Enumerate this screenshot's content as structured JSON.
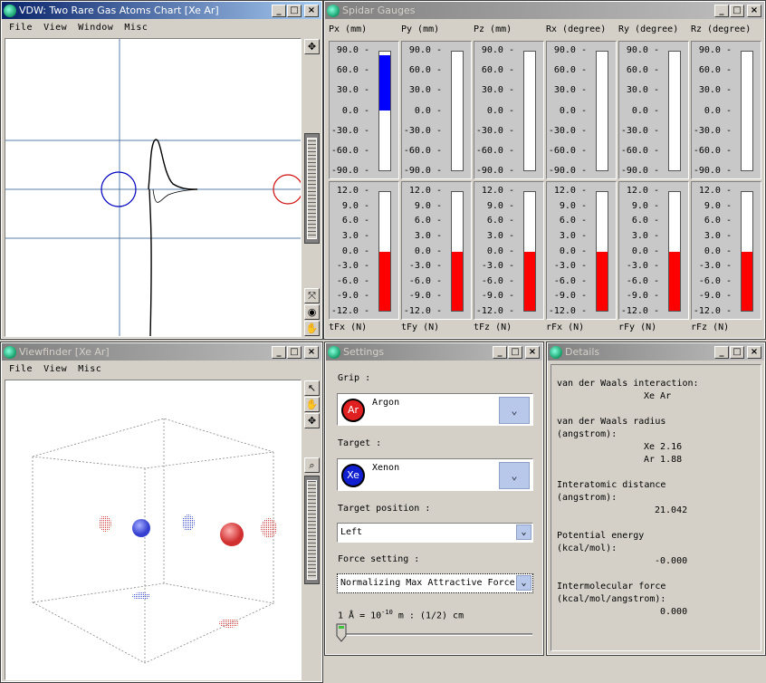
{
  "vdw": {
    "title": "VDW: Two Rare Gas Atoms Chart [Xe Ar]",
    "menu": [
      "File",
      "View",
      "Window",
      "Misc"
    ]
  },
  "viewfinder": {
    "title": "Viewfinder [Xe Ar]",
    "menu": [
      "File",
      "View",
      "Misc"
    ]
  },
  "gauges": {
    "title": "Spidar Gauges",
    "top_labels": [
      "Px (mm)",
      "Py (mm)",
      "Pz (mm)",
      "Rx (degree)",
      "Ry (degree)",
      "Rz (degree)"
    ],
    "top_ticks": [
      "90.0",
      "60.0",
      "30.0",
      "0.0",
      "-30.0",
      "-60.0",
      "-90.0"
    ],
    "top_values": [
      85,
      0,
      0,
      0,
      0,
      0
    ],
    "top_range": [
      -90,
      90
    ],
    "bottom_labels": [
      "tFx (N)",
      "tFy (N)",
      "tFz (N)",
      "rFx (N)",
      "rFy (N)",
      "rFz (N)"
    ],
    "bottom_ticks": [
      "12.0",
      "9.0",
      "6.0",
      "3.0",
      "0.0",
      "-3.0",
      "-6.0",
      "-9.0",
      "-12.0"
    ],
    "bottom_values": [
      -12,
      -12,
      -12,
      -12,
      -12,
      -12
    ],
    "bottom_range": [
      -12,
      12
    ],
    "top_color": "#0000ff",
    "bottom_color": "#ff0000"
  },
  "settings": {
    "title": "Settings",
    "grip_label": "Grip :",
    "grip_name": "Argon",
    "grip_symbol": "Ar",
    "grip_color": "#e02020",
    "target_label": "Target :",
    "target_name": "Xenon",
    "target_symbol": "Xe",
    "target_color": "#1020d0",
    "position_label": "Target position :",
    "position_value": "Left",
    "force_label": "Force setting :",
    "force_value": "Normalizing Max Attractive Force",
    "scale_prefix": "1 Å  = 10",
    "scale_exp": "-10",
    "scale_suffix": " m : (1/2) cm",
    "slider_value": 0
  },
  "details": {
    "title": "Details",
    "interaction_label": "van der Waals interaction:",
    "interaction_value": "Xe Ar",
    "radius_label": "van der Waals radius",
    "radius_unit": "(angstrom):",
    "radius_xe": "Xe 2.16",
    "radius_ar": "Ar 1.88",
    "distance_label": "Interatomic distance",
    "distance_unit": "(angstrom):",
    "distance_value": "21.042",
    "energy_label": "Potential energy",
    "energy_unit": "(kcal/mol):",
    "energy_value": "-0.000",
    "force_label": "Intermolecular force",
    "force_unit": "(kcal/mol/angstrom):",
    "force_value": "0.000"
  }
}
